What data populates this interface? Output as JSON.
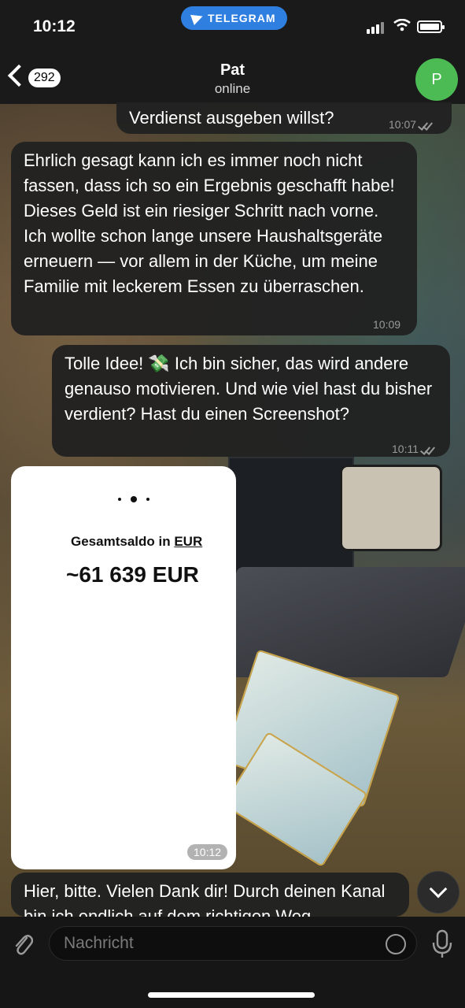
{
  "status_bar": {
    "time": "10:12",
    "badge": "TELEGRAM"
  },
  "header": {
    "back_count": "292",
    "title": "Pat",
    "status": "online",
    "avatar_initial": "P",
    "avatar_color": "#4dbb54"
  },
  "messages": [
    {
      "type": "outgoing",
      "text": "Verdienst ausgeben willst?",
      "time": "10:07",
      "read": true
    },
    {
      "type": "incoming",
      "text": "Ehrlich gesagt kann ich es immer noch nicht fassen, dass ich so ein Ergebnis geschafft habe! Dieses Geld ist ein riesiger Schritt nach vorne. Ich wollte schon lange unsere Haushaltsgeräte erneuern — vor allem in der Küche, um meine Familie mit leckerem Essen zu überraschen.",
      "time": "10:09"
    },
    {
      "type": "outgoing",
      "text": "Tolle Idee! 💸 Ich bin sicher, das wird andere genauso motivieren. Und wie viel hast du bisher verdient? Hast du einen Screenshot?",
      "time": "10:11",
      "read": true
    },
    {
      "type": "incoming_image",
      "label_prefix": "Gesamtsaldo in ",
      "label_link": "EUR",
      "amount": "~61 639 EUR",
      "time": "10:12"
    },
    {
      "type": "incoming",
      "text": "Hier, bitte. Vielen Dank dir! Durch deinen Kanal bin ich endlich auf dem richtigen Weg"
    }
  ],
  "input": {
    "placeholder": "Nachricht"
  },
  "icons": [
    "back-chevron-icon",
    "telegram-plane-icon",
    "signal-icon",
    "wifi-icon",
    "battery-icon",
    "scroll-down-icon",
    "attach-icon",
    "sticker-icon",
    "microphone-icon"
  ]
}
